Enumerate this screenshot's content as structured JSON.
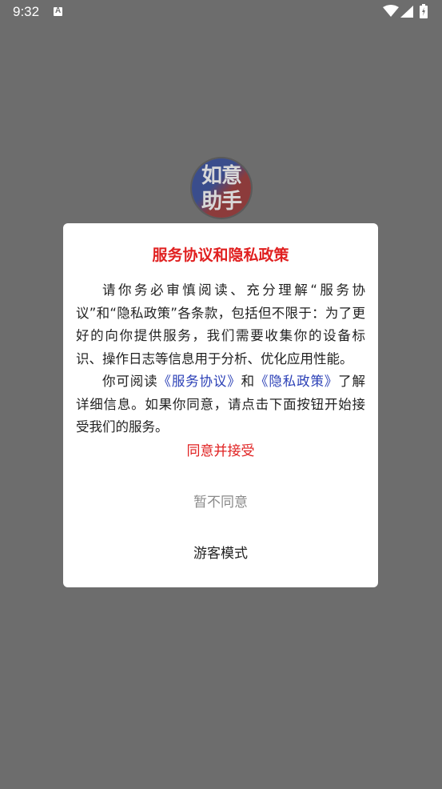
{
  "status_bar": {
    "time": "9:32",
    "notification_icon": "a-icon",
    "icons": [
      "wifi-icon",
      "signal-icon",
      "battery-icon"
    ]
  },
  "app_logo": {
    "text": "如意助手"
  },
  "dialog": {
    "title": "服务协议和隐私政策",
    "paragraph1": "请你务必审慎阅读、充分理解“服务协议”和“隐私政策”各条款，包括但不限于：为了更好的向你提供服务，我们需要收集你的设备标识、操作日志等信息用于分析、优化应用性能。",
    "paragraph2_prefix": "你可阅读",
    "service_link": "《服务协议》",
    "and_text": "和",
    "privacy_link": "《隐私政策》",
    "paragraph2_suffix": "了解详细信息。如果你同意，请点击下面按钮开始接受我们的服务。",
    "agree_button": "同意并接受",
    "disagree_button": "暂不同意",
    "guest_button": "游客模式"
  },
  "colors": {
    "scrim": "#6d6d6d",
    "title_red": "#e02020",
    "link_blue": "#2a3fb6",
    "disabled_gray": "#8a8a8a"
  }
}
